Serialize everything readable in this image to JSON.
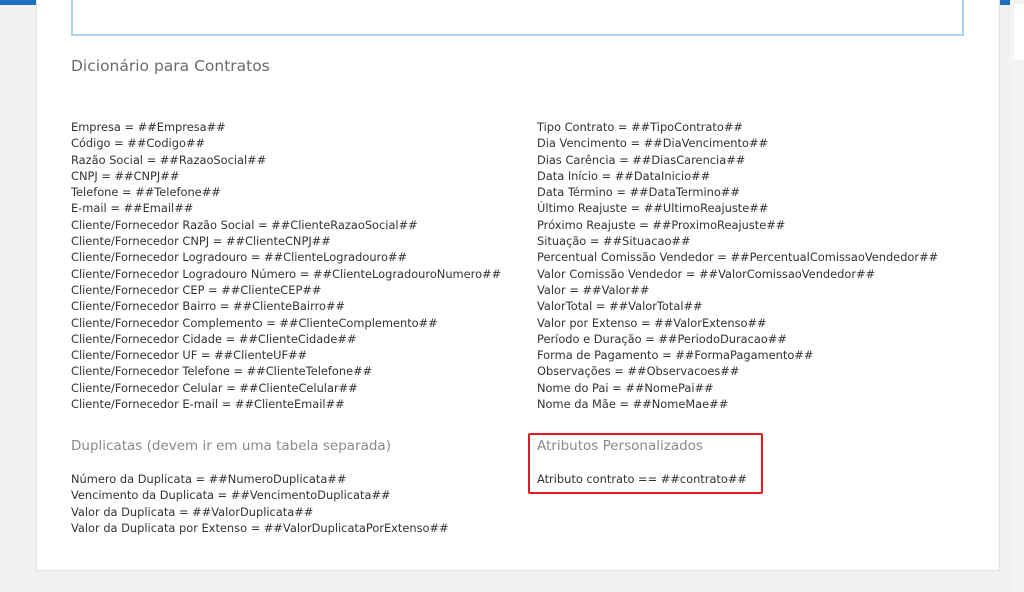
{
  "title": "Dicionário para Contratos",
  "left_fields": [
    "Empresa = ##Empresa##",
    "Código = ##Codigo##",
    "Razão Social = ##RazaoSocial##",
    "CNPJ = ##CNPJ##",
    "Telefone = ##Telefone##",
    "E-mail = ##Email##",
    "Cliente/Fornecedor Razão Social = ##ClienteRazaoSocial##",
    "Cliente/Fornecedor CNPJ = ##ClienteCNPJ##",
    "Cliente/Fornecedor Logradouro = ##ClienteLogradouro##",
    "Cliente/Fornecedor Logradouro Número = ##ClienteLogradouroNumero##",
    "Cliente/Fornecedor CEP = ##ClienteCEP##",
    "Cliente/Fornecedor Bairro = ##ClienteBairro##",
    "Cliente/Fornecedor Complemento = ##ClienteComplemento##",
    "Cliente/Fornecedor Cidade = ##ClienteCidade##",
    "Cliente/Fornecedor UF = ##ClienteUF##",
    "Cliente/Fornecedor Telefone = ##ClienteTelefone##",
    "Cliente/Fornecedor Celular = ##ClienteCelular##",
    "Cliente/Fornecedor E-mail = ##ClienteEmail##"
  ],
  "right_fields": [
    "Tipo Contrato = ##TipoContrato##",
    "Dia Vencimento = ##DiaVencimento##",
    "Dias Carência = ##DiasCarencia##",
    "Data Início = ##DataInicio##",
    "Data Término = ##DataTermino##",
    "Último Reajuste = ##UltimoReajuste##",
    "Próximo Reajuste = ##ProximoReajuste##",
    "Situação = ##Situacao##",
    "Percentual Comissão Vendedor = ##PercentualComissaoVendedor##",
    "Valor Comissão Vendedor = ##ValorComissaoVendedor##",
    "Valor = ##Valor##",
    "ValorTotal = ##ValorTotal##",
    "Valor por Extenso = ##ValorExtenso##",
    "Período e Duração = ##PeriodoDuracao##",
    "Forma de Pagamento = ##FormaPagamento##",
    "Observações = ##Observacoes##",
    "Nome do Pai = ##NomePai##",
    "Nome da Mãe = ##NomeMae##"
  ],
  "duplicatas": {
    "heading": "Duplicatas (devem ir em uma tabela separada)",
    "fields": [
      "Número da Duplicata = ##NumeroDuplicata##",
      "Vencimento da Duplicata = ##VencimentoDuplicata##",
      "Valor da Duplicata = ##ValorDuplicata##",
      "Valor da Duplicata por Extenso = ##ValorDuplicataPorExtenso##"
    ]
  },
  "atributos": {
    "heading": "Atributos Personalizados",
    "fields": [
      "Atributo contrato == ##contrato##"
    ]
  },
  "colors": {
    "topbar": "#1e6fc0",
    "highlight_border": "#e31b23",
    "panel_border": "#a9d4ec"
  }
}
